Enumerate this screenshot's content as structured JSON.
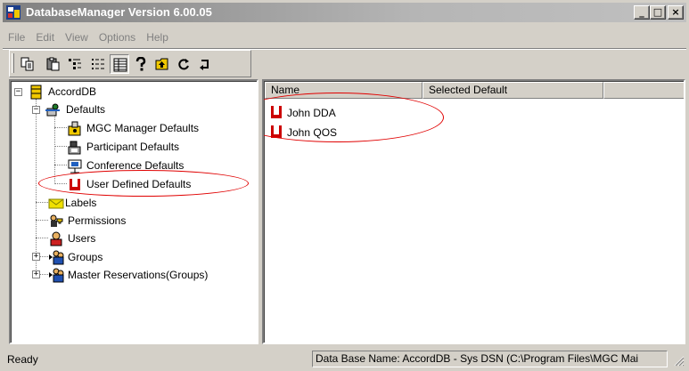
{
  "window": {
    "title": "DatabaseManager Version 6.00.05",
    "minimize": "_",
    "maximize": "□",
    "close": "×"
  },
  "menu": [
    "File",
    "Edit",
    "View",
    "Options",
    "Help"
  ],
  "toolbar": [
    "copy-icon",
    "paste-icon",
    "tree-view-icon",
    "details-view-icon",
    "grid-view-icon",
    "help-icon",
    "up-folder-icon",
    "refresh-icon",
    "rotate-icon"
  ],
  "tree": {
    "root": "AccordDB",
    "defaults": "Defaults",
    "mgc_manager_defaults": "MGC Manager Defaults",
    "participant_defaults": "Participant Defaults",
    "conference_defaults": "Conference Defaults",
    "user_defined_defaults": "User Defined Defaults",
    "labels": "Labels",
    "permissions": "Permissions",
    "users": "Users",
    "groups": "Groups",
    "master_reservations": "Master Reservations(Groups)",
    "expand_plus": "+",
    "collapse_minus": "−"
  },
  "list": {
    "columns": [
      "Name",
      "Selected Default",
      ""
    ],
    "rows": [
      {
        "name": "John DDA",
        "selected_default": ""
      },
      {
        "name": "John QOS",
        "selected_default": ""
      }
    ]
  },
  "status": {
    "ready": "Ready",
    "db_info": "Data Base Name: AccordDB - Sys DSN (C:\\Program Files\\MGC Mai"
  },
  "colors": {
    "annotation": "#e00000",
    "selection_red": "#cc0000",
    "folder_yellow": "#f0c800"
  }
}
